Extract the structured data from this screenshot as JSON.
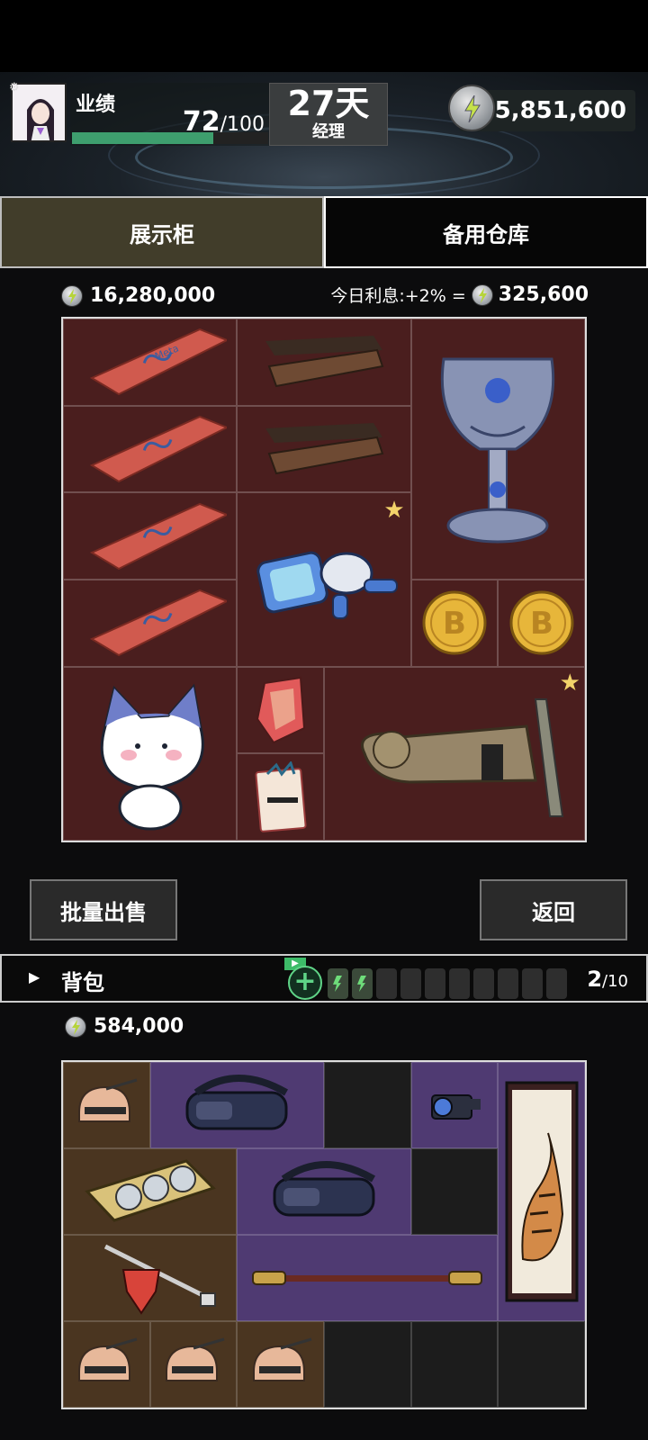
{
  "header": {
    "performance_label": "业绩",
    "performance_current": "72",
    "performance_max": "/100",
    "performance_fraction": 0.72,
    "days": "27天",
    "role": "经理",
    "money": "5,851,600"
  },
  "tabs": [
    {
      "label": "展示柜",
      "active": true
    },
    {
      "label": "备用仓库",
      "active": false
    }
  ],
  "cabinet": {
    "value": "16,280,000",
    "interest_label": "今日利息:+2% =",
    "interest_amount": "325,600"
  },
  "buttons": {
    "bulk_sell": "批量出售",
    "back": "返回"
  },
  "backpack": {
    "title": "背包",
    "count": "2",
    "max": "/10",
    "value": "584,000",
    "ad_tag": "▶"
  },
  "item_icons": {
    "meta_card": "meta-account-card-icon",
    "wood_bar": "wooden-bar-icon",
    "trophy": "crystal-goblet-icon",
    "robot": "robot-icon",
    "bitcoin": "bitcoin-icon",
    "cat": "cat-plush-icon",
    "gem": "gem-icon",
    "card": "collectible-card-icon",
    "statue": "statue-icon",
    "helmet": "helmet-icon",
    "vr": "vr-headset-icon",
    "camera": "camera-icon",
    "tiger": "tiger-painting-icon",
    "gpu": "graphics-card-icon",
    "tool": "tool-icon",
    "staff": "staff-icon"
  },
  "colors": {
    "cabinet_bg": "#4a1e1e",
    "bag_brown": "#4a3520",
    "bag_purple": "#4f3a72",
    "progress_fill": "#3e9e6e"
  }
}
